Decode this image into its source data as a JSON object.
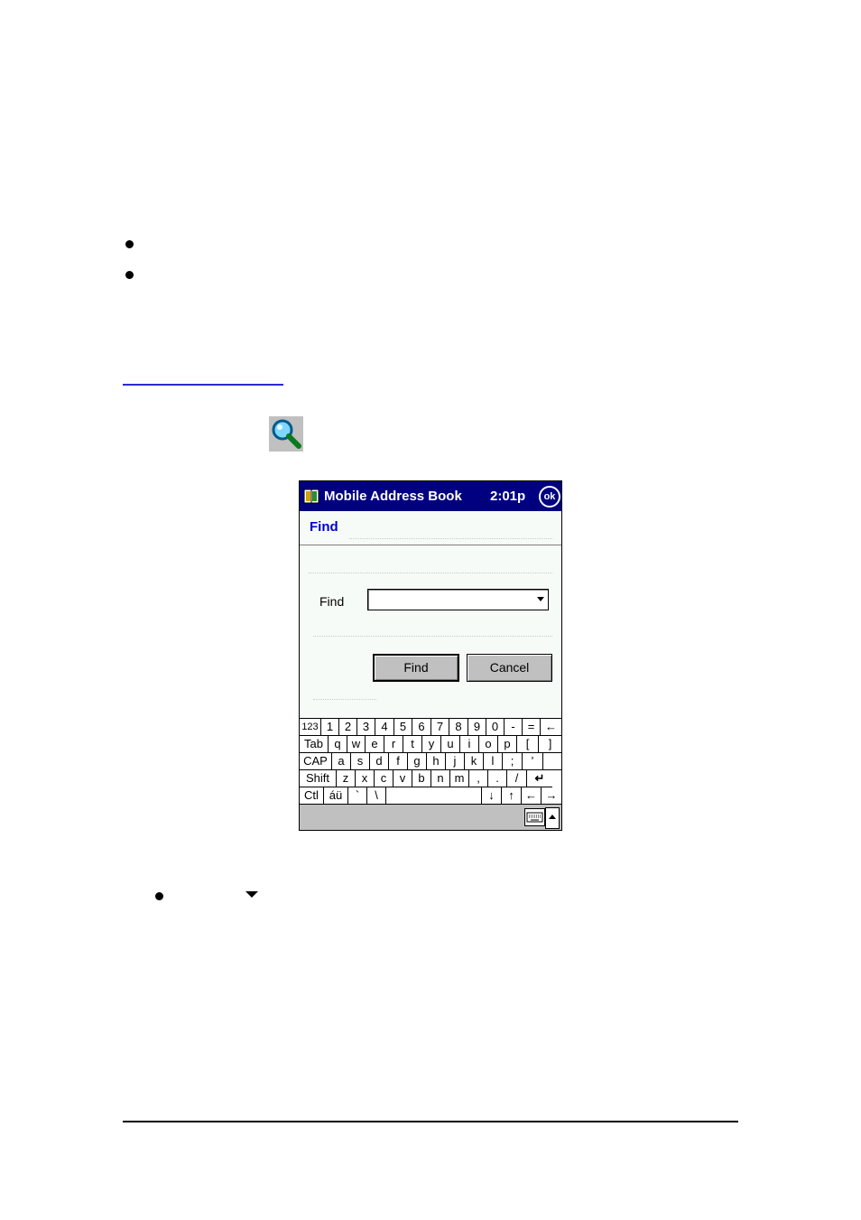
{
  "pocket_pc": {
    "title": "Mobile Address Book",
    "clock": "2:01p",
    "ok_label": "ok",
    "heading": "Find",
    "find_label": "Find",
    "find_value": "",
    "find_button": "Find",
    "cancel_button": "Cancel",
    "colors": {
      "titlebar": "#000080",
      "heading": "#0000c8"
    }
  },
  "keyboard": {
    "rows": [
      [
        "123",
        "1",
        "2",
        "3",
        "4",
        "5",
        "6",
        "7",
        "8",
        "9",
        "0",
        "-",
        "=",
        "←"
      ],
      [
        "Tab",
        "q",
        "w",
        "e",
        "r",
        "t",
        "y",
        "u",
        "i",
        "o",
        "p",
        "[",
        "]"
      ],
      [
        "CAP",
        "a",
        "s",
        "d",
        "f",
        "g",
        "h",
        "j",
        "k",
        "l",
        ";",
        "'"
      ],
      [
        "Shift",
        "z",
        "x",
        "c",
        "v",
        "b",
        "n",
        "m",
        ",",
        ".",
        "/",
        "↵"
      ],
      [
        "Ctl",
        "áü",
        "`",
        "\\",
        " ",
        "↓",
        "↑",
        "←",
        "→"
      ]
    ]
  },
  "icons": [
    "search-icon",
    "dropdown-arrow-icon",
    "keyboard-icon"
  ]
}
